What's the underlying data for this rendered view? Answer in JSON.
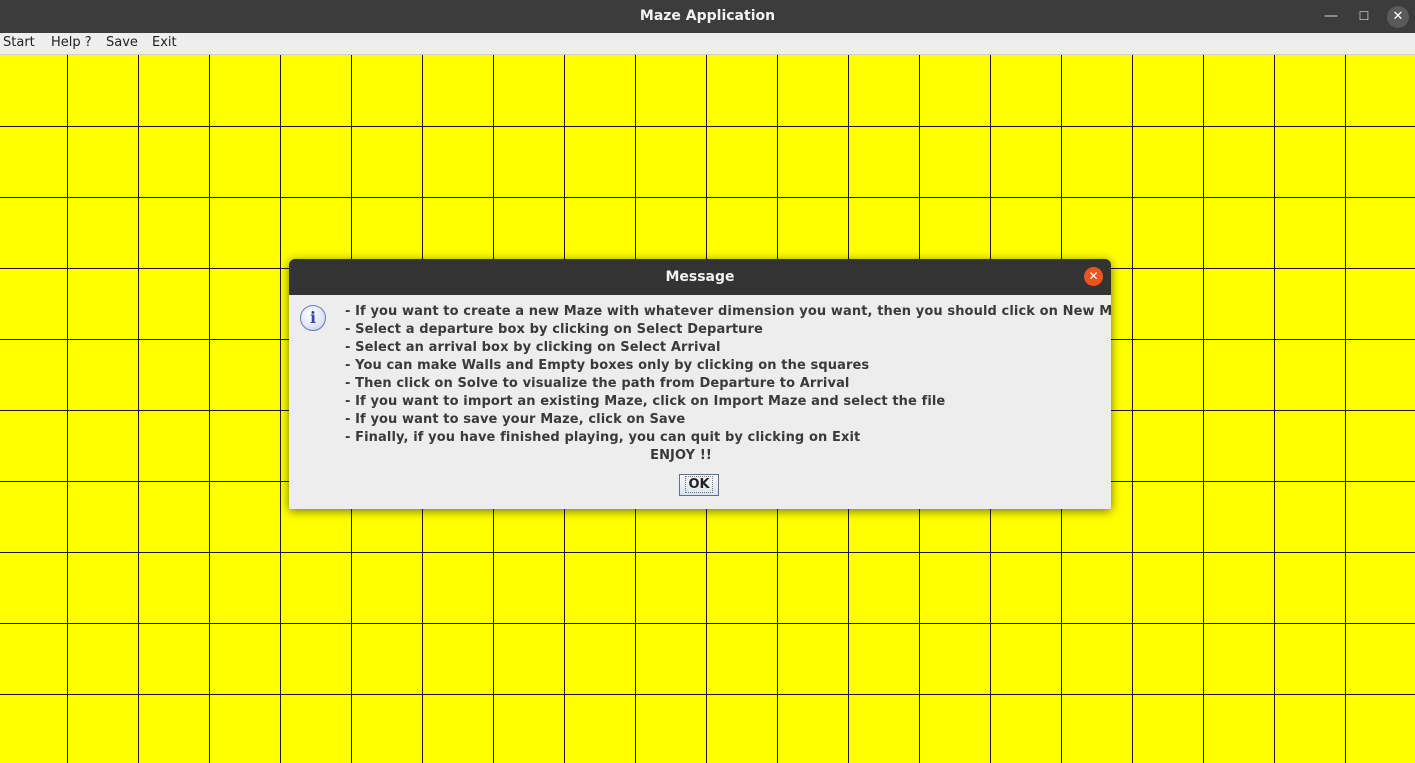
{
  "window": {
    "title": "Maze Application",
    "minimize_glyph": "—",
    "maximize_glyph": "☐",
    "close_glyph": "✕"
  },
  "menu": {
    "items": [
      {
        "label": "Start"
      },
      {
        "label": "Help ?"
      },
      {
        "label": "Save"
      },
      {
        "label": "Exit"
      }
    ]
  },
  "maze": {
    "cell_color": "#ffff00",
    "line_color": "#1a1a00"
  },
  "dialog": {
    "title": "Message",
    "close_glyph": "✕",
    "icon": "info-icon",
    "icon_glyph": "i",
    "lines": [
      "- If you want to create a new Maze with whatever dimension you want, then you should click on New Maze",
      "- Select a departure box by clicking on Select Departure",
      "- Select an arrival box by clicking on Select Arrival",
      "- You can make Walls and Empty boxes only by clicking on the squares",
      "- Then click on Solve to visualize the path from Departure to Arrival",
      "- If you want to import an existing Maze, click on Import Maze and select the file",
      "- If you want to save your Maze, click on Save",
      "- Finally, if you have finished playing, you can quit by clicking on Exit"
    ],
    "closing": "ENJOY !!",
    "ok_label": "OK"
  }
}
